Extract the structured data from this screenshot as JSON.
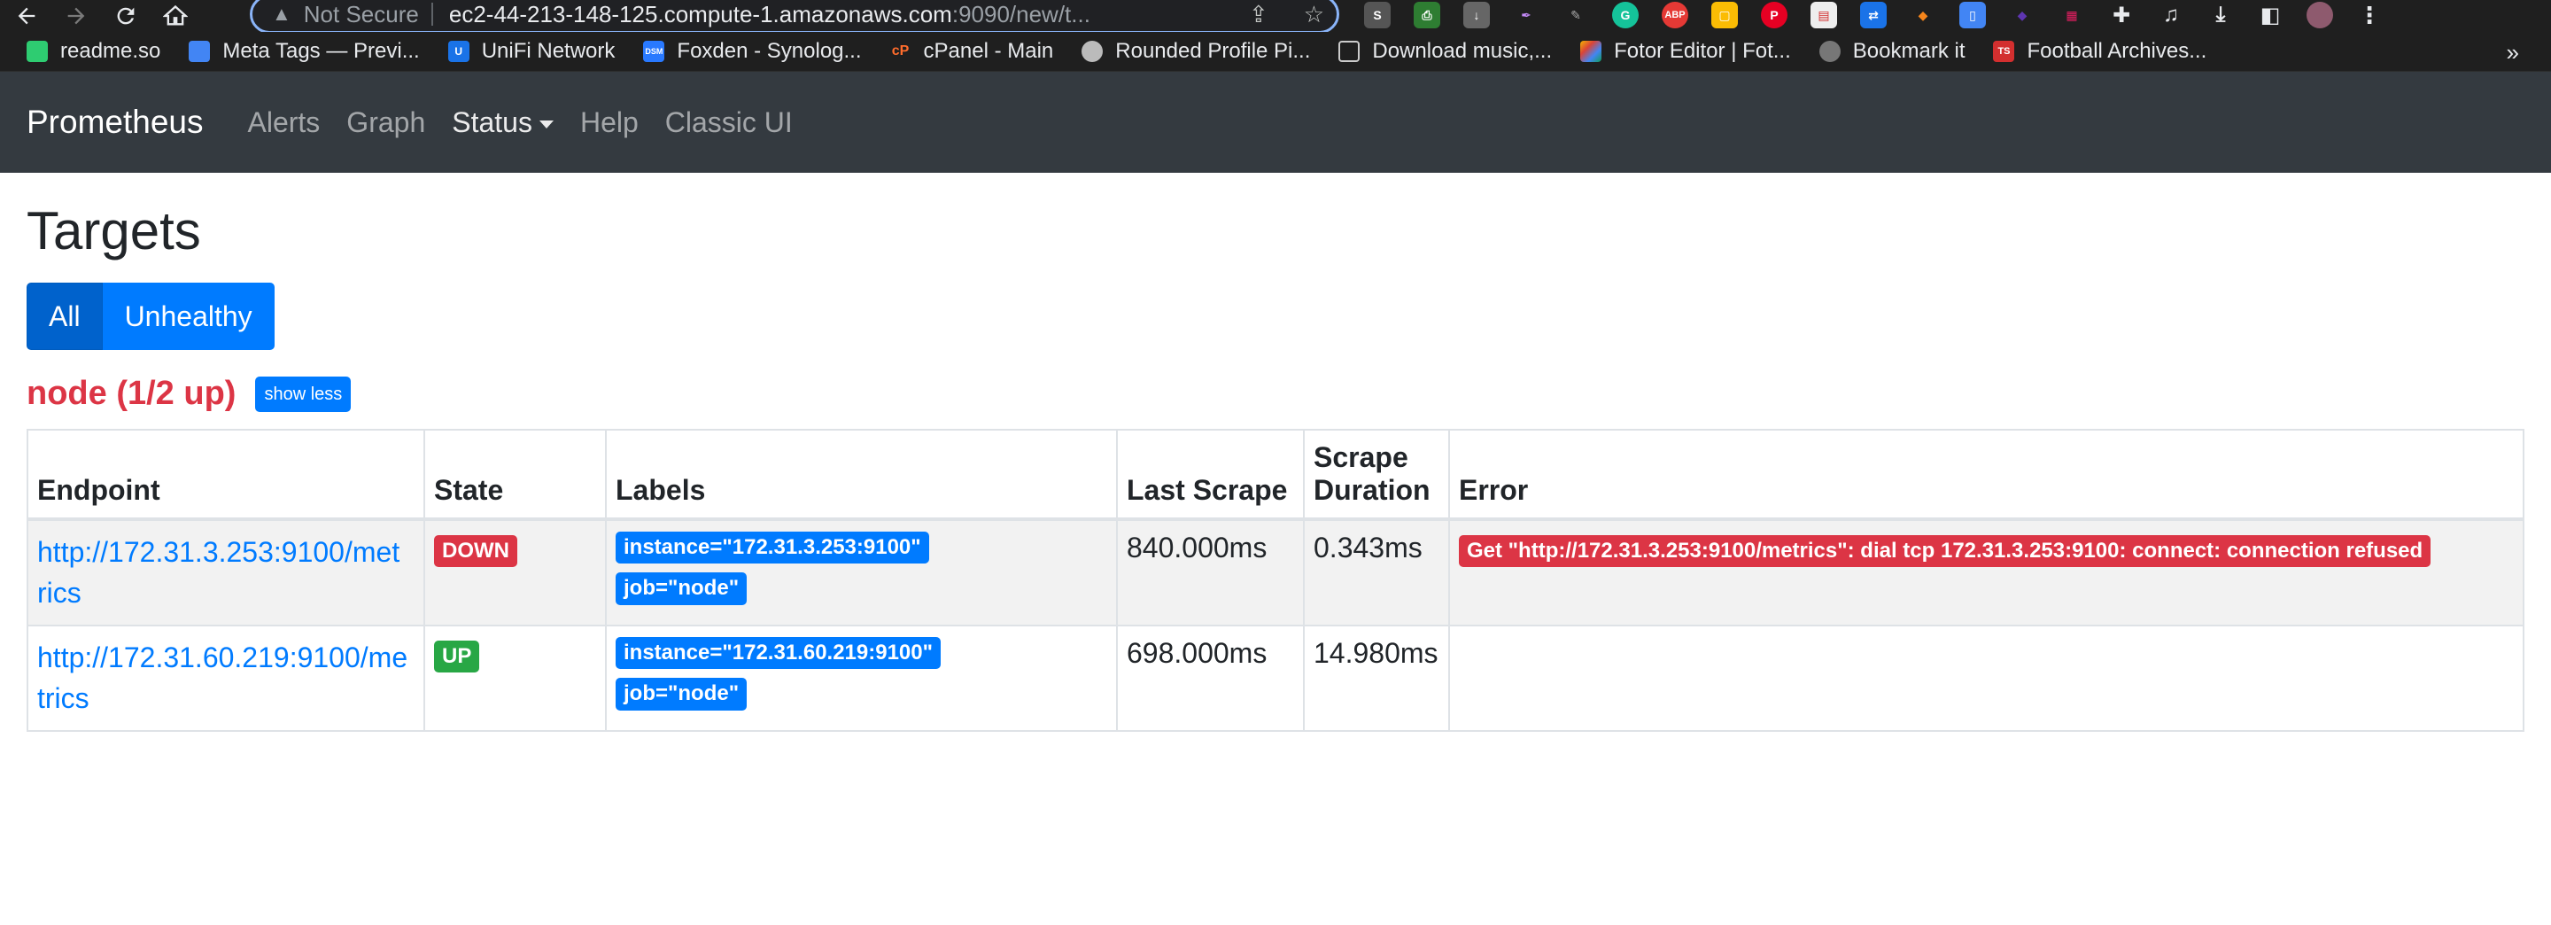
{
  "browser": {
    "security_label": "Not Secure",
    "url_host": "ec2-44-213-148-125.compute-1.amazonaws.com",
    "url_rest": ":9090/new/t...",
    "bookmarks": [
      {
        "label": "readme.so",
        "color": "#2ecc71"
      },
      {
        "label": "Meta Tags — Previ...",
        "color": "#4285f4"
      },
      {
        "label": "UniFi Network",
        "color": "#1a73e8"
      },
      {
        "label": "Foxden - Synolog...",
        "color": "#2979ff"
      },
      {
        "label": "cPanel - Main",
        "color": "#ff6c2c"
      },
      {
        "label": "Rounded Profile Pi...",
        "color": "#666666"
      },
      {
        "label": "Download music,...",
        "color": "#999999"
      },
      {
        "label": "Fotor Editor | Fot...",
        "color": "#f4b400"
      },
      {
        "label": "Bookmark it",
        "color": "#777777"
      },
      {
        "label": "Football Archives...",
        "color": "#d32f2f"
      }
    ],
    "bookmarks_more": "»"
  },
  "navbar": {
    "brand": "Prometheus",
    "links": {
      "alerts": "Alerts",
      "graph": "Graph",
      "status": "Status",
      "help": "Help",
      "classic": "Classic UI"
    }
  },
  "page": {
    "title": "Targets",
    "filter_all": "All",
    "filter_unhealthy": "Unhealthy"
  },
  "pool": {
    "title": "node (1/2 up)",
    "toggle_label": "show less"
  },
  "table": {
    "headers": {
      "endpoint": "Endpoint",
      "state": "State",
      "labels": "Labels",
      "last_scrape": "Last Scrape",
      "scrape_duration_1": "Scrape",
      "scrape_duration_2": "Duration",
      "error": "Error"
    },
    "rows": [
      {
        "endpoint_1": "http://172.31.3.253:9100/met",
        "endpoint_2": "rics",
        "state": "DOWN",
        "label_instance": "instance=\"172.31.3.253:9100\"",
        "label_job": "job=\"node\"",
        "last_scrape": "840.000ms",
        "scrape_duration": "0.343ms",
        "error": "Get \"http://172.31.3.253:9100/metrics\": dial tcp 172.31.3.253:9100: connect: connection refused"
      },
      {
        "endpoint_1": "http://172.31.60.219:9100/me",
        "endpoint_2": "trics",
        "state": "UP",
        "label_instance": "instance=\"172.31.60.219:9100\"",
        "label_job": "job=\"node\"",
        "last_scrape": "698.000ms",
        "scrape_duration": "14.980ms",
        "error": ""
      }
    ]
  }
}
